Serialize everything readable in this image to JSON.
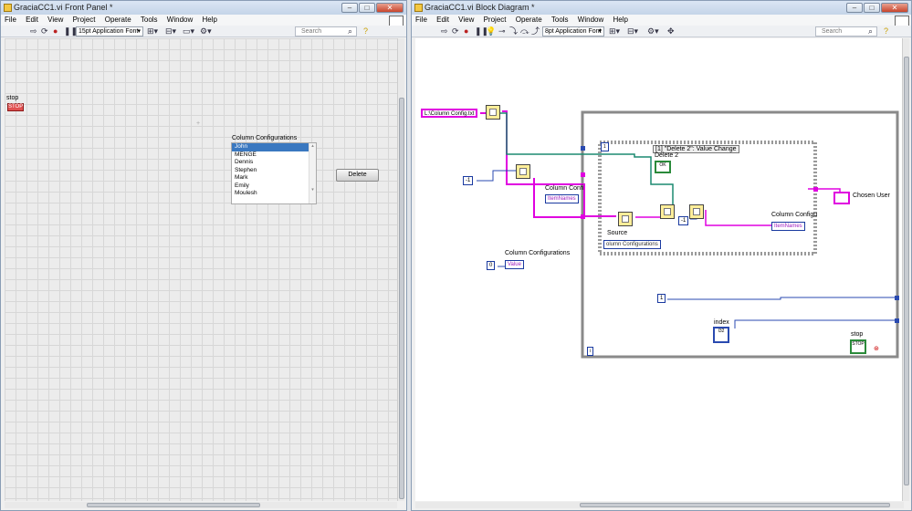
{
  "front_panel": {
    "title": "GraciaCC1.vi Front Panel *",
    "menu": [
      "File",
      "Edit",
      "View",
      "Project",
      "Operate",
      "Tools",
      "Window",
      "Help"
    ],
    "font_select": "15pt Application Font",
    "search_placeholder": "Search",
    "stop_label": "stop",
    "stop_button": "STOP",
    "listbox_label": "Column Configurations",
    "listbox_items": [
      "John",
      "MENGE",
      "Dennis",
      "Stephen",
      "Mark",
      "Emily",
      "Moulesh"
    ],
    "listbox_selected": "John",
    "delete_button": "Delete"
  },
  "block_diagram": {
    "title": "GraciaCC1.vi Block Diagram *",
    "menu": [
      "File",
      "Edit",
      "View",
      "Project",
      "Operate",
      "Tools",
      "Window",
      "Help"
    ],
    "font_select": "8pt Application Font",
    "search_placeholder": "Search",
    "path_const": "L:\\Column Config.txt",
    "neg_one_a": "-1",
    "neg_one_b": "-1",
    "prop_node_a_label": "Column Confi",
    "prop_node_a_prop": "ItemNames",
    "prop_node_b_label": "Column Configu",
    "prop_node_b_prop": "ItemNames",
    "event_case": "[1] \"Delete 2\": Value Change",
    "event_index": "1",
    "delete2_label": "Delete 2",
    "delete2_term": "OK",
    "source_label": "Source",
    "source_ref": "olumn Configurations",
    "chosen_user": "Chosen User",
    "value_label": "Column Configurations",
    "value_prop": "Value",
    "zero_const": "0",
    "one_const": "1",
    "index_label": "index",
    "index_term": "I32",
    "stop_label": "stop",
    "stop_term": "STOP",
    "loop_iter": "i"
  }
}
